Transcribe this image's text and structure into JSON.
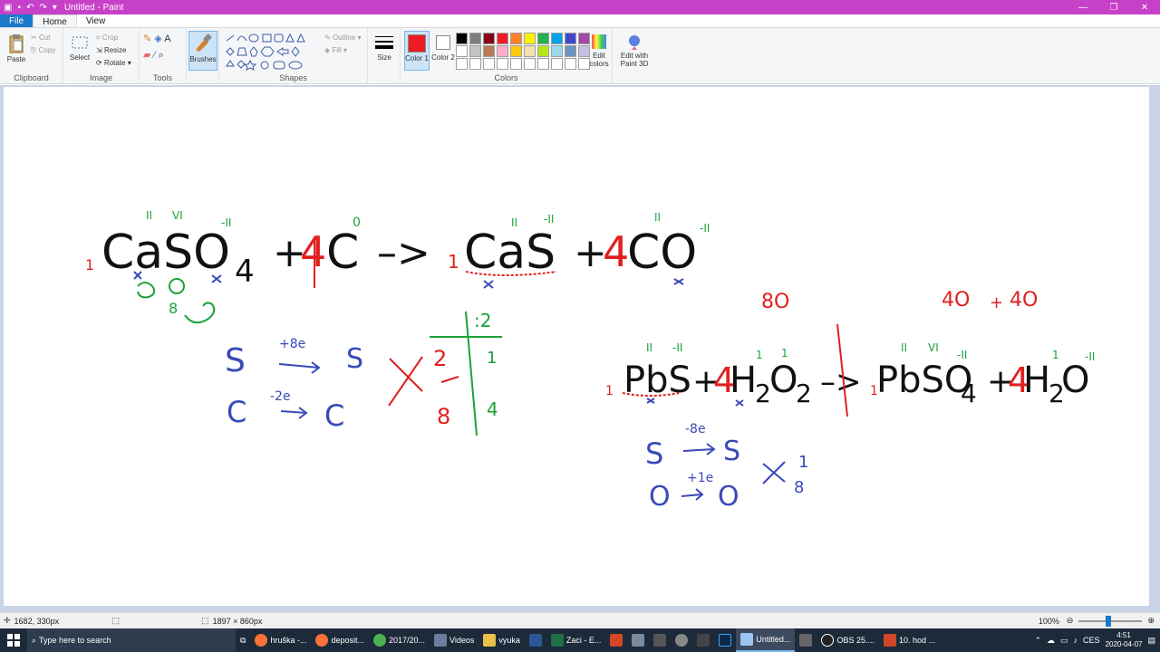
{
  "window": {
    "title": "Untitled - Paint"
  },
  "tabs": {
    "file": "File",
    "home": "Home",
    "view": "View"
  },
  "ribbon": {
    "paste": "Paste",
    "cut": "Cut",
    "copy": "Copy",
    "clipboard": "Clipboard",
    "select": "Select",
    "crop": "Crop",
    "resize": "Resize",
    "rotate": "Rotate",
    "image": "Image",
    "tools": "Tools",
    "brushes": "Brushes",
    "shapes": "Shapes",
    "outline": "Outline",
    "fill": "Fill",
    "size": "Size",
    "color1": "Color 1",
    "color2": "Color 2",
    "edit_colors": "Edit colors",
    "edit_3d": "Edit with Paint 3D",
    "colors": "Colors"
  },
  "palette": [
    "#000000",
    "#7f7f7f",
    "#880015",
    "#ed1c24",
    "#ff7f27",
    "#fff200",
    "#22b14c",
    "#00a2e8",
    "#3f48cc",
    "#a349a4",
    "#ffffff",
    "#c3c3c3",
    "#b97a57",
    "#ffaec9",
    "#ffc90e",
    "#efe4b0",
    "#b5e61d",
    "#99d9ea",
    "#7092be",
    "#c8bfe7",
    "#ffffff",
    "#ffffff",
    "#ffffff",
    "#ffffff",
    "#ffffff",
    "#ffffff",
    "#ffffff",
    "#ffffff",
    "#ffffff",
    "#ffffff"
  ],
  "colors": {
    "color1": "#ed1c24",
    "color2": "#ffffff",
    "accent": "#c640c8"
  },
  "drawing": {
    "eq1": {
      "caso": "CaSO",
      "sub4": "4",
      "plus": "+",
      "coef": "4",
      "c": "C",
      "arrow": "–>",
      "one": "1",
      "cas": "CaS",
      "co": "CO"
    },
    "eq2": {
      "pbs": "PbS",
      "plus": "+",
      "coef": "4",
      "h": "H",
      "two": "2",
      "o": "O",
      "arrow": "–>",
      "one": "1",
      "pbso": "PbSO",
      "four": "4"
    },
    "red": {
      "n8o": "8O",
      "n4o": "4O",
      "plus": "+",
      "n4o_b": "4O",
      "n2": "2",
      "n8": "8",
      "coef": "4"
    },
    "green": {
      "div2": ":2",
      "n1": "1",
      "n4": "4",
      "n8": "8",
      "ii": "II",
      "vi": "VI",
      "minus_ii": "-II",
      "zero": "0"
    },
    "blue": {
      "s": "S",
      "c": "C",
      "plus8e": "+8e",
      "minus2e": "-2e",
      "minus8e": "-8e",
      "plus1e": "+1e",
      "o": "O",
      "n1": "1",
      "n8": "8"
    }
  },
  "status": {
    "cursor": "1682, 330px",
    "size": "1897 × 860px",
    "zoom": "100%"
  },
  "taskbar": {
    "search": "Type here to search",
    "items": [
      "hruška -...",
      "deposit...",
      "2017/20...",
      "Videos",
      "vyuka",
      "Zaci - E...",
      "Untitled...",
      "OBS 25....",
      "10. hod ..."
    ],
    "lang": "CES",
    "time": "4:51",
    "date": "2020-04-07"
  }
}
